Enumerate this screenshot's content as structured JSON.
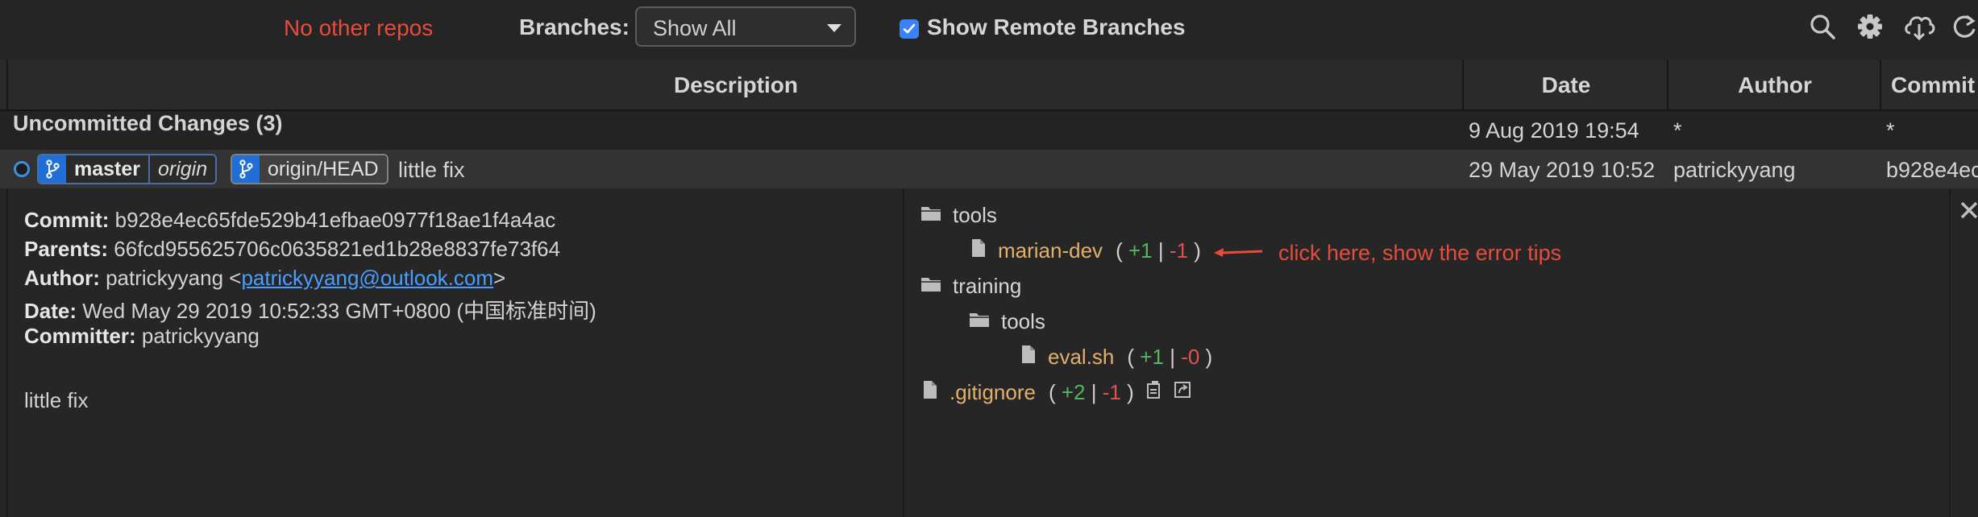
{
  "toolbar": {
    "repo_status": "No other repos",
    "branches_label": "Branches:",
    "branches_selected": "Show All",
    "show_remote_label": "Show Remote Branches",
    "show_remote_checked": true,
    "icons": [
      "search-icon",
      "gear-icon",
      "cloud-download-icon",
      "refresh-icon"
    ]
  },
  "columns": [
    "Description",
    "Date",
    "Author",
    "Commit"
  ],
  "rows": {
    "uncommitted": {
      "description": "Uncommitted Changes (3)",
      "date": "9 Aug 2019 19:54",
      "author": "*",
      "commit": "*"
    },
    "commit": {
      "refs": [
        {
          "name": "master",
          "remote": "origin"
        },
        {
          "name": "origin/HEAD"
        }
      ],
      "message": "little fix",
      "date": "29 May 2019 10:52",
      "author": "patrickyyang",
      "commit": "b928e4ec"
    }
  },
  "details": {
    "commit_label": "Commit:",
    "commit_value": "b928e4ec65fde529b41efbae0977f18ae1f4a4ac",
    "parents_label": "Parents:",
    "parents_value": "66fcd955625706c0635821ed1b28e8837fe73f64",
    "author_label": "Author:",
    "author_name": "patrickyyang <",
    "author_email": "patrickyyang@outlook.com",
    "author_close": ">",
    "date_label": "Date:",
    "date_value": "Wed May 29 2019 10:52:33 GMT+0800 (中国标准时间)",
    "committer_label": "Committer:",
    "committer_value": "patrickyyang",
    "message": "little fix"
  },
  "files": {
    "folder_tools": "tools",
    "file_marian": {
      "name": "marian-dev",
      "open": "(",
      "add": "+1",
      "sep": "|",
      "del": "-1",
      "close": ")"
    },
    "folder_training": "training",
    "folder_training_tools": "tools",
    "file_eval": {
      "name": "eval.sh",
      "open": "(",
      "add": "+1",
      "sep": "|",
      "del": "-0",
      "close": ")"
    },
    "file_gitignore": {
      "name": ".gitignore",
      "open": "(",
      "add": "+2",
      "sep": "|",
      "del": "-1",
      "close": ")"
    }
  },
  "annotation": "click here, show the error tips",
  "colors": {
    "accent": "#3b82f6",
    "error": "#e74c3c",
    "added": "#57b561",
    "deleted": "#e05252",
    "filename": "#e3b06b"
  }
}
